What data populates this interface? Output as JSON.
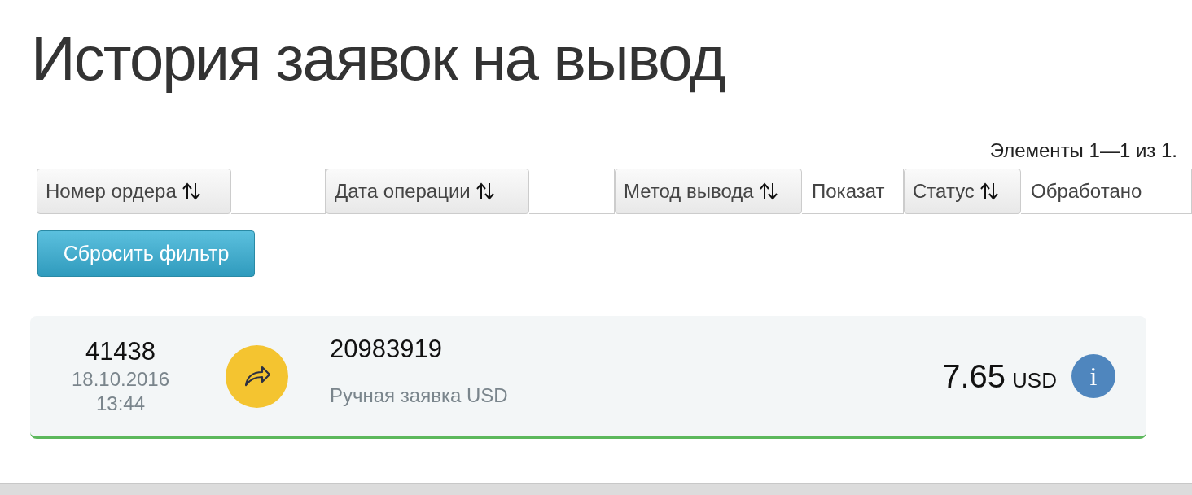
{
  "page_title": "История заявок на вывод",
  "pager_summary": "Элементы 1—1 из 1.",
  "filters": [
    {
      "label": "Номер ордера"
    },
    {
      "label": "Дата операции"
    },
    {
      "label": "Метод вывода",
      "value": "Показат"
    },
    {
      "label": "Статус",
      "value": "Обработано"
    }
  ],
  "reset_button": "Сбросить фильтр",
  "orders": [
    {
      "number": "41438",
      "date": "18.10.2016",
      "time": "13:44",
      "transaction": "20983919",
      "method": "Ручная заявка USD",
      "amount": "7.65",
      "currency": "USD",
      "info": "i"
    }
  ]
}
